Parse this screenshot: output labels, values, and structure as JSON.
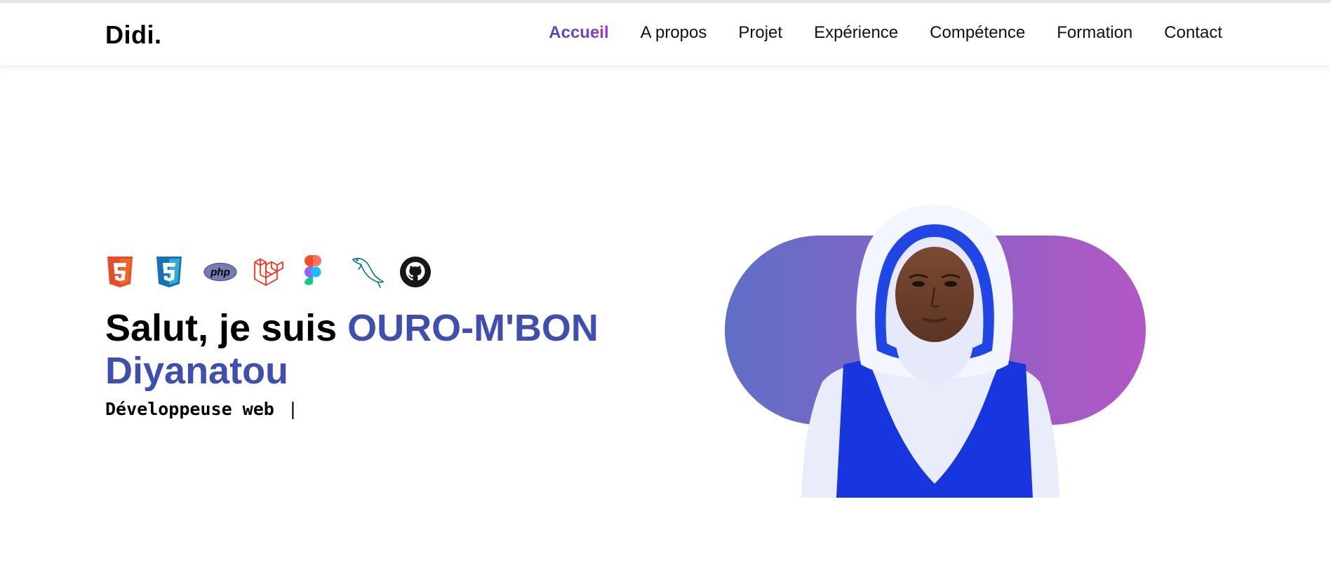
{
  "brand": {
    "logo": "Didi."
  },
  "nav": {
    "items": [
      {
        "label": "Accueil",
        "active": true
      },
      {
        "label": "A propos",
        "active": false
      },
      {
        "label": "Projet",
        "active": false
      },
      {
        "label": "Expérience",
        "active": false
      },
      {
        "label": "Compétence",
        "active": false
      },
      {
        "label": "Formation",
        "active": false
      },
      {
        "label": "Contact",
        "active": false
      }
    ]
  },
  "hero": {
    "greeting": "Salut, je suis ",
    "name": "OURO-M'BON Diyanatou",
    "role": "Développeuse web",
    "cursor": "|",
    "tech_icons": [
      "html5-icon",
      "css3-icon",
      "php-icon",
      "laravel-icon",
      "figma-icon",
      "mysql-icon",
      "github-icon"
    ],
    "php_label": "php"
  },
  "colors": {
    "accent_gradient_start": "#5f6fc6",
    "accent_gradient_end": "#b456c6",
    "name_color": "#3f4fb0",
    "html5": "#e44d26",
    "css3": "#1572b6",
    "php": "#777bb3",
    "laravel": "#ff2d20",
    "github": "#181717",
    "mysql": "#00758f"
  }
}
